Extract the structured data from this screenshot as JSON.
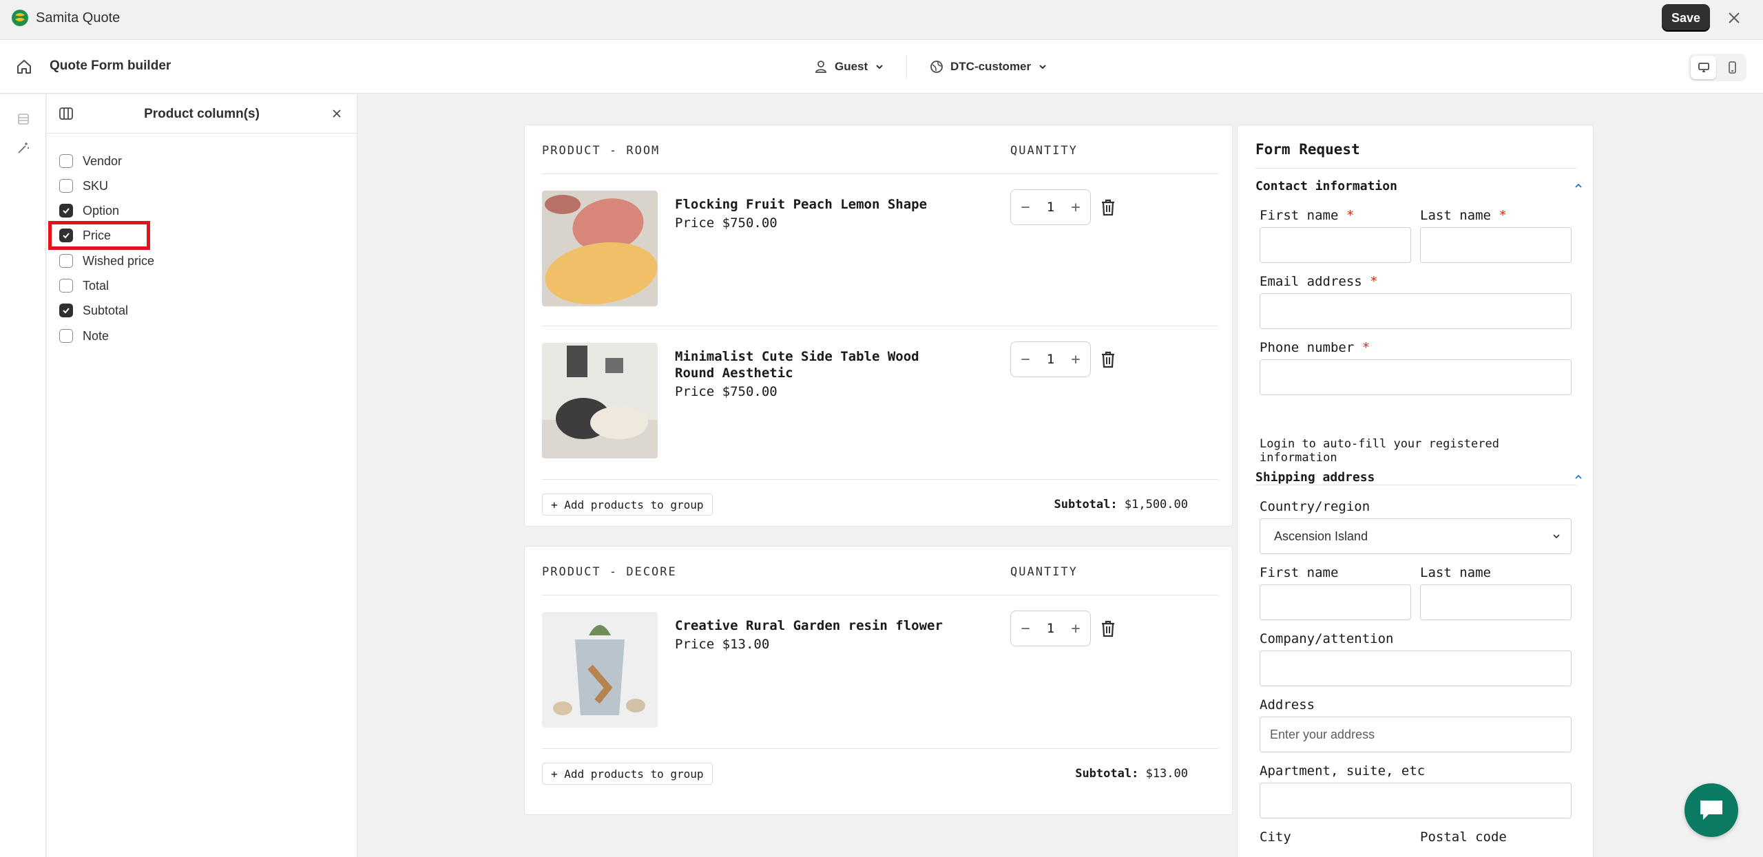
{
  "app": {
    "title": "Samita Quote",
    "save_label": "Save"
  },
  "header": {
    "title": "Quote Form builder",
    "audience": "Guest",
    "market": "DTC-customer"
  },
  "panel": {
    "title": "Product column(s)",
    "options": [
      {
        "label": "Vendor",
        "checked": false
      },
      {
        "label": "SKU",
        "checked": false
      },
      {
        "label": "Option",
        "checked": true
      },
      {
        "label": "Price",
        "checked": true
      },
      {
        "label": "Wished price",
        "checked": false
      },
      {
        "label": "Total",
        "checked": false
      },
      {
        "label": "Subtotal",
        "checked": true
      },
      {
        "label": "Note",
        "checked": false
      }
    ]
  },
  "groups": [
    {
      "title": "PRODUCT - ROOM",
      "qty_header": "QUANTITY",
      "items": [
        {
          "name": "Flocking Fruit Peach Lemon Shape",
          "price": "Price $750.00",
          "qty": "1"
        },
        {
          "name": "Minimalist Cute Side Table Wood Round Aesthetic",
          "price": "Price $750.00",
          "qty": "1"
        }
      ],
      "add_label": "+ Add products to group",
      "subtotal_label": "Subtotal:",
      "subtotal_value": "$1,500.00"
    },
    {
      "title": "PRODUCT - DECORE",
      "qty_header": "QUANTITY",
      "items": [
        {
          "name": "Creative Rural Garden resin flower",
          "price": "Price $13.00",
          "qty": "1"
        }
      ],
      "add_label": "+ Add products to group",
      "subtotal_label": "Subtotal:",
      "subtotal_value": "$13.00"
    }
  ],
  "form": {
    "title": "Form Request",
    "contact": {
      "title": "Contact information",
      "first_name": "First name",
      "last_name": "Last name",
      "email": "Email address",
      "phone": "Phone number",
      "required_mark": "*",
      "note": "Login to auto-fill your registered information"
    },
    "shipping": {
      "title": "Shipping address",
      "country_label": "Country/region",
      "country_value": "Ascension Island",
      "first_name": "First name",
      "last_name": "Last name",
      "company": "Company/attention",
      "address": "Address",
      "address_placeholder": "Enter your address",
      "apartment": "Apartment, suite, etc",
      "city": "City",
      "postal": "Postal code"
    }
  },
  "colors": {
    "accent": "#303030",
    "highlight": "#e8101a",
    "required": "#d72c0d",
    "chat": "#0b7a63"
  }
}
